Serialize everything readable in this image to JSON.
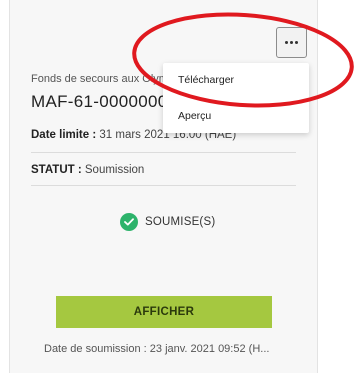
{
  "card": {
    "subtitle": "Fonds de secours aux Olympiques",
    "reference": "MAF-61-000000000",
    "deadline_label": "Date limite :",
    "deadline_value": "31 mars 2021 16:00 (HAE)",
    "status_label": "STATUT :",
    "status_value": "Soumission",
    "badge_label": "SOUMISE(S)",
    "view_button": "AFFICHER",
    "submitted_date": "Date de soumission : 23 janv. 2021 09:52 (H..."
  },
  "menu": {
    "items": [
      {
        "label": "Télécharger"
      },
      {
        "label": "Aperçu"
      }
    ]
  },
  "icons": {
    "more": "more-options-icon",
    "status": "check-circle-icon"
  },
  "colors": {
    "accent_green": "#a5c840",
    "status_green": "#2db36b",
    "annotation_red": "#e0191f"
  }
}
